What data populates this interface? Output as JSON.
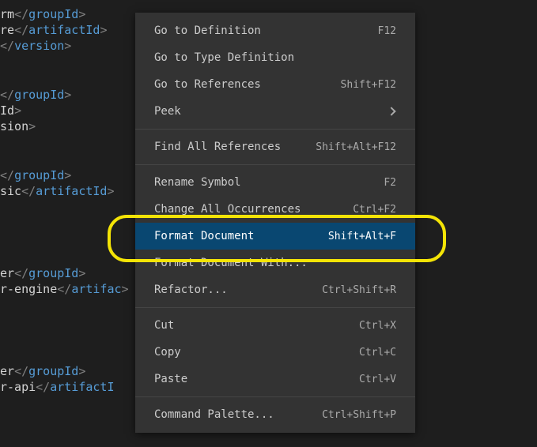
{
  "editor": {
    "lines": [
      {
        "raw": "rm",
        "closeTag": "groupId"
      },
      {
        "raw": "re",
        "closeTag": "artifactId"
      },
      {
        "closeTag": "version"
      },
      {},
      {},
      {
        "closeTag": "groupId"
      },
      {
        "raw": "Id",
        "tagEnd": ">"
      },
      {
        "raw": "sion",
        "tagEnd": ">"
      },
      {},
      {},
      {
        "closeTag": "groupId"
      },
      {
        "raw": "sic",
        "closeTag": "artifactId"
      },
      {},
      {},
      {},
      {},
      {
        "raw": "er",
        "closeTag": "groupId"
      },
      {
        "raw": "r-engine",
        "closeTag": "artifac"
      },
      {},
      {},
      {},
      {},
      {
        "raw": "er",
        "closeTag": "groupId"
      },
      {
        "raw": "r-api",
        "closeTag": "artifactI"
      }
    ]
  },
  "menu": {
    "sections": [
      [
        {
          "label": "Go to Definition",
          "shortcut": "F12"
        },
        {
          "label": "Go to Type Definition",
          "shortcut": ""
        },
        {
          "label": "Go to References",
          "shortcut": "Shift+F12"
        },
        {
          "label": "Peek",
          "shortcut": "",
          "chevron": true
        }
      ],
      [
        {
          "label": "Find All References",
          "shortcut": "Shift+Alt+F12"
        }
      ],
      [
        {
          "label": "Rename Symbol",
          "shortcut": "F2"
        },
        {
          "label": "Change All Occurrences",
          "shortcut": "Ctrl+F2"
        },
        {
          "label": "Format Document",
          "shortcut": "Shift+Alt+F",
          "active": true
        },
        {
          "label": "Format Document With...",
          "shortcut": ""
        },
        {
          "label": "Refactor...",
          "shortcut": "Ctrl+Shift+R"
        }
      ],
      [
        {
          "label": "Cut",
          "shortcut": "Ctrl+X"
        },
        {
          "label": "Copy",
          "shortcut": "Ctrl+C"
        },
        {
          "label": "Paste",
          "shortcut": "Ctrl+V"
        }
      ],
      [
        {
          "label": "Command Palette...",
          "shortcut": "Ctrl+Shift+P"
        }
      ]
    ]
  }
}
